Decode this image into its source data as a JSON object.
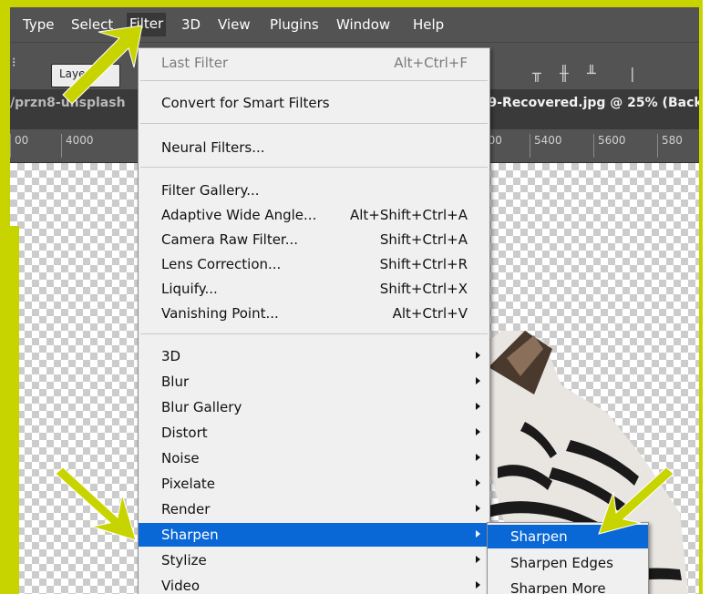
{
  "app": {
    "menubar": [
      "Type",
      "Select",
      "Filter",
      "3D",
      "View",
      "Plugins",
      "Window",
      "Help"
    ],
    "active_menu": "Filter"
  },
  "options_bar": {
    "layer_dropdown": "Layer"
  },
  "tabs": {
    "left": "/przn8-unsplash",
    "right": "539-Recovered.jpg @ 25% (Back"
  },
  "ruler": {
    "left_ticks": [
      "00",
      "4000"
    ],
    "right_ticks": [
      "200",
      "5400",
      "5600",
      "580"
    ]
  },
  "filter_menu": {
    "last_filter": {
      "label": "Last Filter",
      "shortcut": "Alt+Ctrl+F"
    },
    "convert": "Convert for Smart Filters",
    "neural": "Neural Filters...",
    "group_tools": [
      {
        "label": "Filter Gallery...",
        "shortcut": ""
      },
      {
        "label": "Adaptive Wide Angle...",
        "shortcut": "Alt+Shift+Ctrl+A"
      },
      {
        "label": "Camera Raw Filter...",
        "shortcut": "Shift+Ctrl+A"
      },
      {
        "label": "Lens Correction...",
        "shortcut": "Shift+Ctrl+R"
      },
      {
        "label": "Liquify...",
        "shortcut": "Shift+Ctrl+X"
      },
      {
        "label": "Vanishing Point...",
        "shortcut": "Alt+Ctrl+V"
      }
    ],
    "submenus": [
      "3D",
      "Blur",
      "Blur Gallery",
      "Distort",
      "Noise",
      "Pixelate",
      "Render",
      "Sharpen",
      "Stylize",
      "Video"
    ],
    "selected": "Sharpen"
  },
  "sharpen_submenu": {
    "items": [
      "Sharpen",
      "Sharpen Edges",
      "Sharpen More"
    ],
    "selected": "Sharpen"
  },
  "colors": {
    "highlight": "#0a68d6",
    "frame_accent": "#c8d400",
    "arrow": "#c8d400"
  }
}
